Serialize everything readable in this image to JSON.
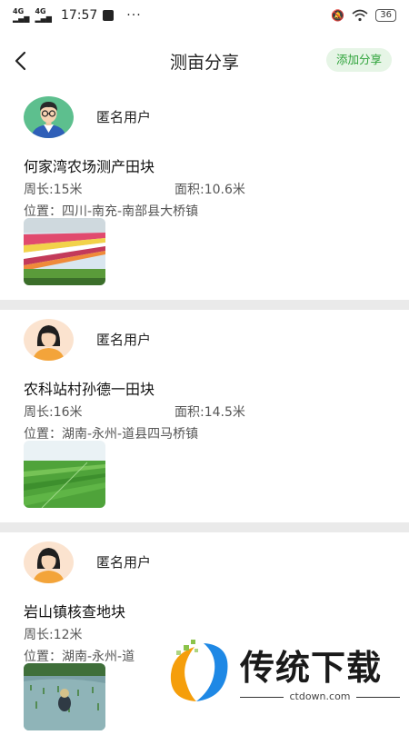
{
  "status_bar": {
    "network_1": "4G",
    "network_2": "4G",
    "time": "17:57",
    "more": "···",
    "battery": "36"
  },
  "header": {
    "title": "测亩分享",
    "add_button": "添加分享"
  },
  "posts": [
    {
      "username": "匿名用户",
      "field_name": "何家湾农场测产田块",
      "perimeter": "周长:15米",
      "area": "面积:10.6米",
      "location": "位置：四川-南充-南部县大桥镇",
      "avatar": "avatar-male-icon"
    },
    {
      "username": "匿名用户",
      "field_name": "农科站村孙德一田块",
      "perimeter": "周长:16米",
      "area": "面积:14.5米",
      "location": "位置：湖南-永州-道县四马桥镇",
      "avatar": "avatar-female-icon"
    },
    {
      "username": "匿名用户",
      "field_name": "岩山镇核查地块",
      "perimeter": "周长:12米",
      "area": "",
      "location": "位置：湖南-永州-道",
      "avatar": "avatar-female-icon"
    }
  ],
  "watermark": {
    "text": "传统下载",
    "url": "ctdown.com"
  },
  "colors": {
    "accent_green": "#2ea33a",
    "button_bg": "#e6f5e6",
    "divider": "#eaeaea"
  }
}
